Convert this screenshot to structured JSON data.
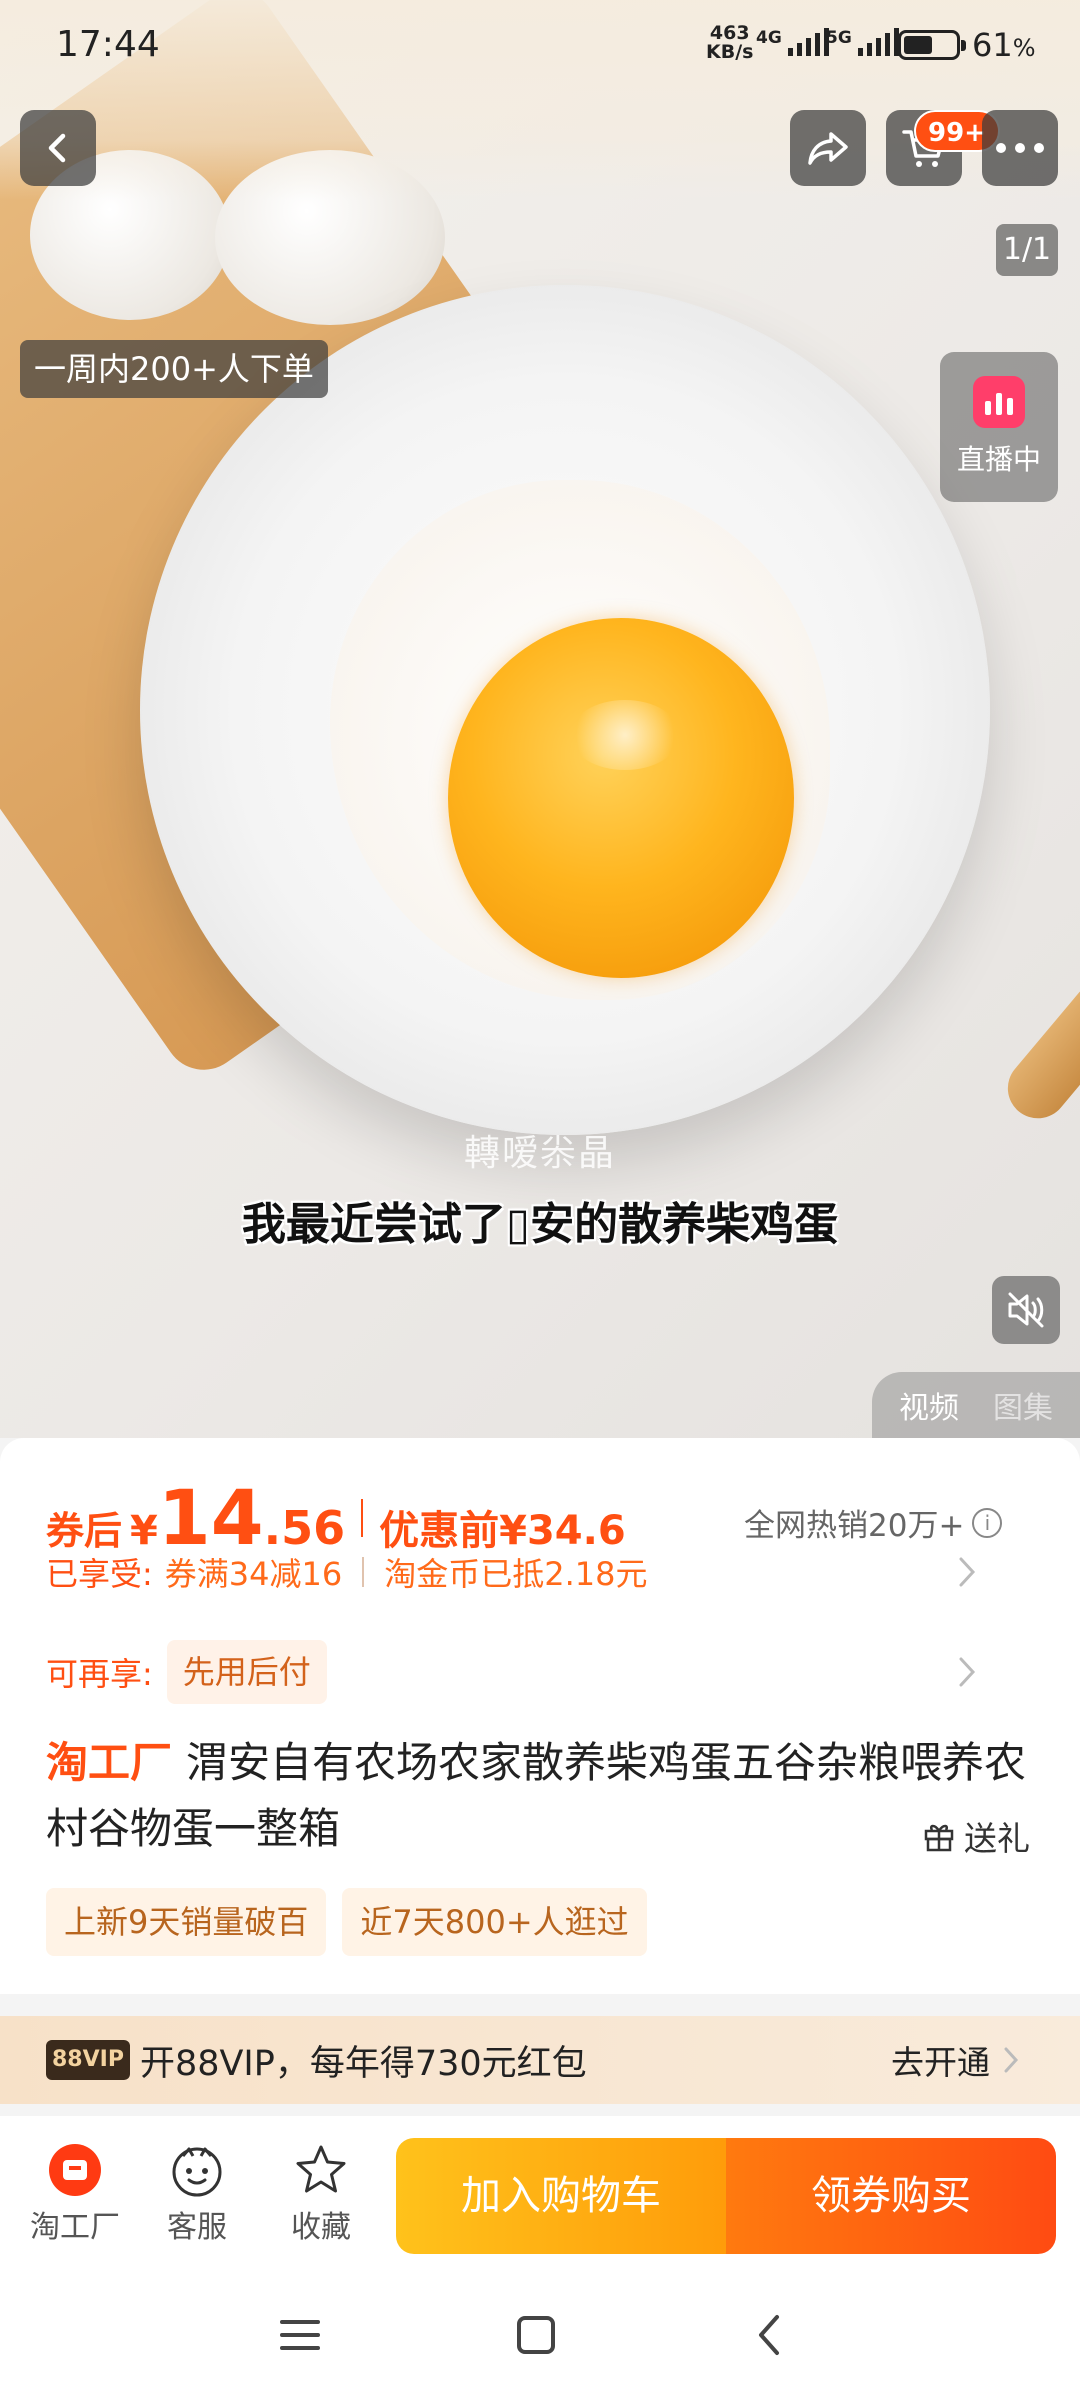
{
  "status_bar": {
    "time": "17:44",
    "net_speed_value": "463",
    "net_speed_unit": "KB/s",
    "signal1_label": "4G",
    "signal2_label": "5G",
    "battery_level": 0.61,
    "battery_pct": "61",
    "battery_unit": "%"
  },
  "top_nav": {
    "cart_badge": "99+",
    "icons": [
      "back-icon",
      "share-icon",
      "cart-icon",
      "more-icon"
    ]
  },
  "media": {
    "counter": "1/1",
    "orders_badge": "一周内200+人下单",
    "live_label": "直播中",
    "watermark": "轉嗳尜晶",
    "subtitle": "我最近尝试了▯安的散养柴鸡蛋",
    "tabs": [
      {
        "label": "视频",
        "active": true
      },
      {
        "label": "图集",
        "active": false
      }
    ]
  },
  "product": {
    "price_label": "券后",
    "currency": "¥",
    "price_int": "14",
    "price_dec": ".56",
    "orig_price": "优惠前¥34.6",
    "hot_sales": "全网热销20万+",
    "enjoyed_label": "已享受:",
    "enjoyed_coupon": "券满34减16",
    "enjoyed_coins": "淘金币已抵2.18元",
    "more_label": "可再享:",
    "more_value": "先用后付",
    "brand": "淘工厂",
    "title": "渭安自有农场农家散养柴鸡蛋五谷杂粮喂养农村谷物蛋一整箱",
    "gift_label": "送礼",
    "tags": [
      "上新9天销量破百",
      "近7天800+人逛过"
    ]
  },
  "vip": {
    "badge": "88VIP",
    "text": "开88VIP，每年得730元红包",
    "cta": "去开通"
  },
  "action_bar": {
    "store_label": "淘工厂",
    "service_label": "客服",
    "favorite_label": "收藏",
    "add_cart_label": "加入购物车",
    "buy_label": "领券购买"
  },
  "colors": {
    "accent": "#ff4f12",
    "cart_button": "#ffb114",
    "buy_button": "#ff5a12",
    "live": "#ff3e6a"
  }
}
